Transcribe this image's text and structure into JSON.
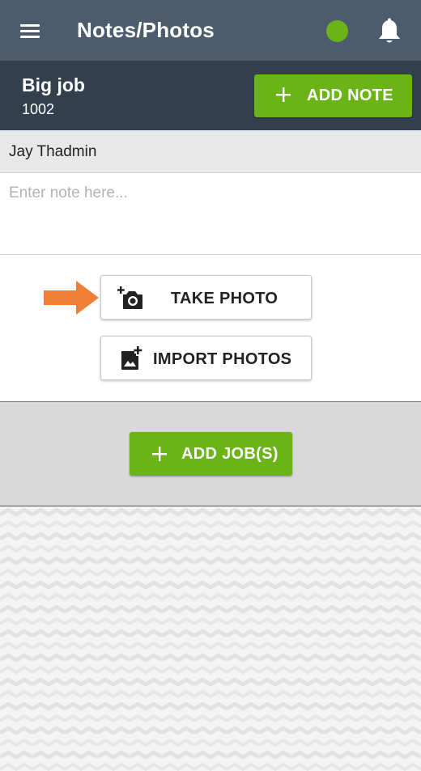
{
  "header": {
    "title": "Notes/Photos",
    "menu_icon": "hamburger-menu-icon",
    "status_icon": "online-status-dot",
    "status_color": "#6ab417",
    "notification_icon": "bell-icon"
  },
  "job": {
    "name": "Big job",
    "number": "1002",
    "add_note_label": "ADD NOTE"
  },
  "note": {
    "author": "Jay Thadmin",
    "placeholder": "Enter note here...",
    "value": ""
  },
  "photos": {
    "take_photo_label": "TAKE PHOTO",
    "import_photos_label": "IMPORT PHOTOS",
    "take_photo_icon": "add-camera-icon",
    "import_photos_icon": "add-image-icon",
    "pointer_icon": "arrow-right-icon"
  },
  "jobs": {
    "add_jobs_label": "ADD JOB(S)"
  },
  "colors": {
    "header_bg": "#4d5c6c",
    "job_bar_bg": "#323f4d",
    "accent_green": "#6ab417",
    "pointer_orange": "#ef7f32"
  }
}
